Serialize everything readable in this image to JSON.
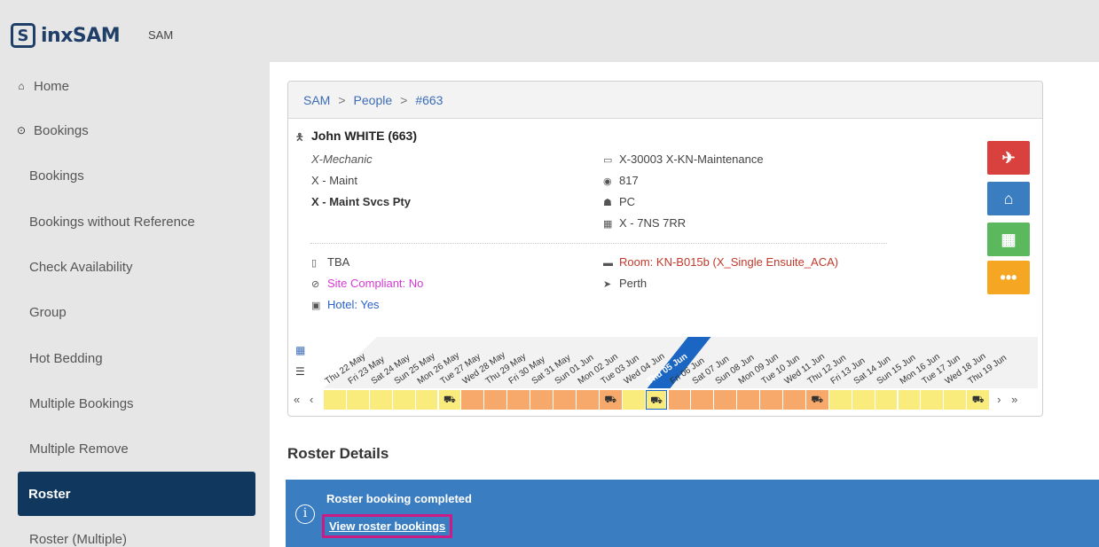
{
  "header": {
    "logo_text": "inxSAM",
    "logo_mark": "S",
    "app_name": "SAM"
  },
  "sidebar": {
    "items": [
      {
        "label": "Home",
        "icon": "home-icon"
      },
      {
        "label": "Bookings",
        "icon": "circle-arrow-icon"
      },
      {
        "label": "Bookings"
      },
      {
        "label": "Bookings without Reference"
      },
      {
        "label": "Check Availability"
      },
      {
        "label": "Group"
      },
      {
        "label": "Hot Bedding"
      },
      {
        "label": "Multiple Bookings"
      },
      {
        "label": "Multiple Remove"
      },
      {
        "label": "Roster",
        "active": true
      },
      {
        "label": "Roster (Multiple)"
      }
    ]
  },
  "breadcrumb": [
    "SAM",
    "People",
    "#663"
  ],
  "person": {
    "name": "John WHITE (663)",
    "role": "X-Mechanic",
    "department": "X - Maint",
    "company": "X - Maint Svcs Pty",
    "cost_centre": "X-30003 X-KN-Maintenance",
    "views": "817",
    "group": "PC",
    "roster": "X - 7NS 7RR",
    "phone": "TBA",
    "site_compliant": "Site Compliant: No",
    "hotel": "Hotel: Yes",
    "room": "Room: KN-B015b (X_Single Ensuite_ACA)",
    "location": "Perth"
  },
  "action_buttons": [
    {
      "name": "flight-button",
      "color": "#d9413f",
      "glyph": "✈"
    },
    {
      "name": "accommodation-button",
      "color": "#3a7dc0",
      "glyph": "⌂"
    },
    {
      "name": "roster-calendar-button",
      "color": "#5cb85c",
      "glyph": "▦"
    },
    {
      "name": "more-options-button",
      "color": "#f5a623",
      "glyph": "•••"
    }
  ],
  "calendar": {
    "dates": [
      "Thu 22 May",
      "Fri 23 May",
      "Sat 24 May",
      "Sun 25 May",
      "Mon 26 May",
      "Tue 27 May",
      "Wed 28 May",
      "Thu 29 May",
      "Fri 30 May",
      "Sat 31 May",
      "Sun 01 Jun",
      "Mon 02 Jun",
      "Tue 03 Jun",
      "Wed 04 Jun",
      "Thu 05 Jun",
      "Fri 06 Jun",
      "Sat 07 Jun",
      "Sun 08 Jun",
      "Mon 09 Jun",
      "Tue 10 Jun",
      "Wed 11 Jun",
      "Thu 12 Jun",
      "Fri 13 Jun",
      "Sat 14 Jun",
      "Sun 15 Jun",
      "Mon 16 Jun",
      "Tue 17 Jun",
      "Wed 18 Jun",
      "Thu 19 Jun"
    ],
    "today": "Thu 05 Jun",
    "cells": [
      "RR",
      "RR",
      "RR",
      "RR",
      "RR",
      "car",
      "NS",
      "NS",
      "NS",
      "NS",
      "NS",
      "NS",
      "car",
      "RR",
      "car",
      "NS",
      "NS",
      "NS",
      "NS",
      "NS",
      "NS",
      "car",
      "RR",
      "RR",
      "RR",
      "RR",
      "RR",
      "RR",
      "car"
    ],
    "nav": {
      "first": "«",
      "prev": "‹",
      "next": "›",
      "last": "»"
    }
  },
  "roster_details": {
    "title": "Roster Details",
    "message": "Roster booking completed",
    "link": "View roster bookings"
  }
}
